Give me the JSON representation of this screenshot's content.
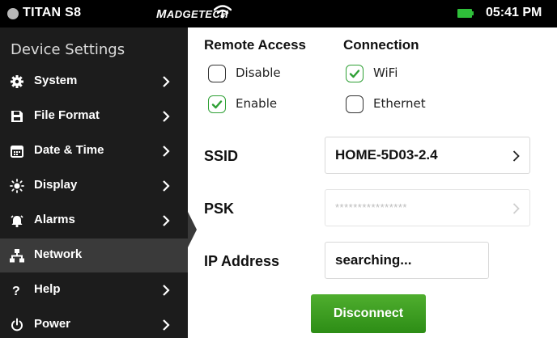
{
  "status_bar": {
    "device_name": "TITAN S8",
    "brand_prefix": "M",
    "brand_rest": "ADGETECH",
    "time": "05:41 PM",
    "icons": [
      "status-dot",
      "wifi-icon",
      "battery-icon"
    ],
    "battery_color": "#2fbf3a"
  },
  "sidebar": {
    "title": "Device Settings",
    "items": [
      {
        "label": "System",
        "icon": "gear-icon"
      },
      {
        "label": "File Format",
        "icon": "save-icon"
      },
      {
        "label": "Date & Time",
        "icon": "calendar-icon"
      },
      {
        "label": "Display",
        "icon": "brightness-icon"
      },
      {
        "label": "Alarms",
        "icon": "alarm-bell-icon"
      },
      {
        "label": "Network",
        "icon": "network-icon",
        "active": true
      },
      {
        "label": "Help",
        "icon": "help-icon"
      },
      {
        "label": "Power",
        "icon": "power-icon"
      }
    ]
  },
  "remote_access": {
    "heading": "Remote Access",
    "options": [
      {
        "label": "Disable",
        "checked": false
      },
      {
        "label": "Enable",
        "checked": true
      }
    ]
  },
  "connection": {
    "heading": "Connection",
    "options": [
      {
        "label": "WiFi",
        "checked": true
      },
      {
        "label": "Ethernet",
        "checked": false
      }
    ]
  },
  "fields": {
    "ssid": {
      "label": "SSID",
      "value": "HOME-5D03-2.4"
    },
    "psk": {
      "label": "PSK",
      "value": "****************"
    },
    "ip": {
      "label": "IP Address",
      "value": "searching..."
    }
  },
  "disconnect_button": {
    "label": "Disconnect",
    "color": "#3a9c22"
  },
  "accent_color": "#2fa035"
}
